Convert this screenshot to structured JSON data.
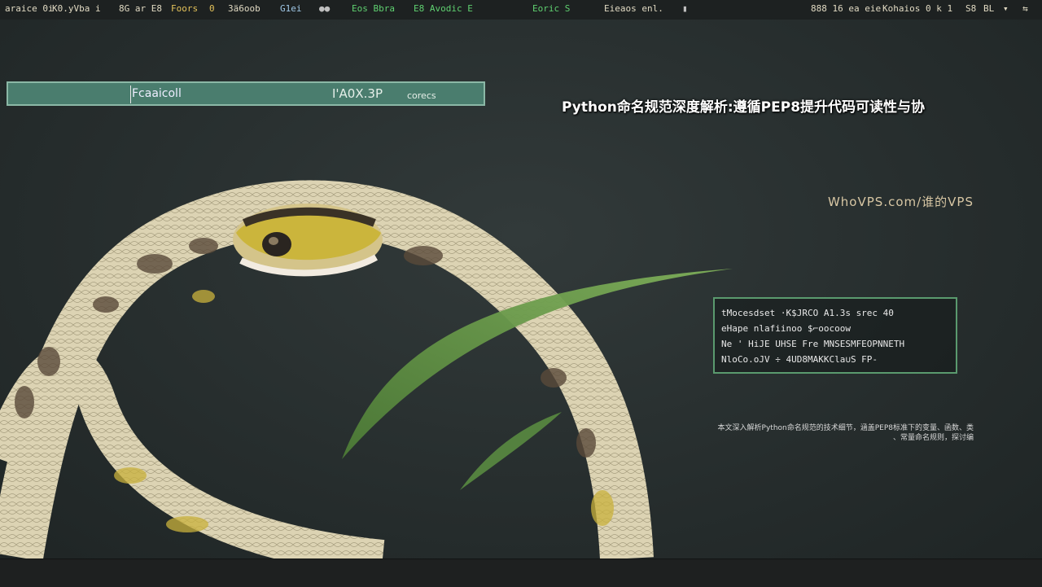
{
  "topbar": {
    "items": [
      {
        "text": "araice 0i",
        "color": "#e0d9c2"
      },
      {
        "text": "K0.yVba i",
        "color": "#e0d9c2"
      },
      {
        "text": "8G ar E8",
        "color": "#e0d9c2"
      },
      {
        "text": "Foors",
        "color": "#e4c25a"
      },
      {
        "text": "0",
        "color": "#e4c25a"
      },
      {
        "text": "3ä6oob",
        "color": "#e0d9c2"
      },
      {
        "text": "G1ei",
        "color": "#9fc7e6"
      },
      {
        "text": "●●",
        "color": "#bfbfbf"
      },
      {
        "text": "Eos Bbra",
        "color": "#5fd070"
      },
      {
        "text": "E8 Avodic  E",
        "color": "#5fd070"
      },
      {
        "text": "Eoric S",
        "color": "#5fd070"
      },
      {
        "text": "Eieaos enl.",
        "color": "#e0d9c2"
      },
      {
        "text": "▮",
        "color": "#bfbfbf"
      },
      {
        "text": "888 16 ea eie",
        "color": "#e0d9c2"
      },
      {
        "text": "Kohaios 0 k  1",
        "color": "#e0d9c2"
      },
      {
        "text": "S8",
        "color": "#e0d9c2"
      },
      {
        "text": "BL",
        "color": "#e0d9c2"
      },
      {
        "text": "▾",
        "color": "#e0d9c2"
      },
      {
        "text": "⇆",
        "color": "#e0d9c2"
      }
    ]
  },
  "search": {
    "value": "Fcaaicoll",
    "meta": "I'A0X.3P",
    "meta_unit": "corecs"
  },
  "page": {
    "title": "Python命名规范深度解析:遵循PEP8提升代码可读性与协",
    "site": "WhoVPS.com/谁的VPS"
  },
  "info_panel": {
    "lines": [
      "tMocesdset ·K$JRCO  A1.3s  srec 40",
      "eHape  nlafiinoo  $⌐oocoow",
      "Ne  ' HiJE  UHSE  Fre  MNSESMFEOPNNETH",
      "NloCo.oJV ÷ 4UD8MAKKCla∪S FP-"
    ]
  },
  "summary": {
    "line1": "本文深入解析Python命名规范的技术细节，涵盖PEP8标准下的变量、函数、类",
    "line2": "、常量命名规则，探讨编"
  },
  "colors": {
    "background": "#262c2c",
    "search_fill": "#4a7d6e",
    "panel_border": "#5a9a6e",
    "snake_body": "#d9cfae",
    "snake_head": "#c9b640",
    "leaf": "#5c8f42"
  }
}
